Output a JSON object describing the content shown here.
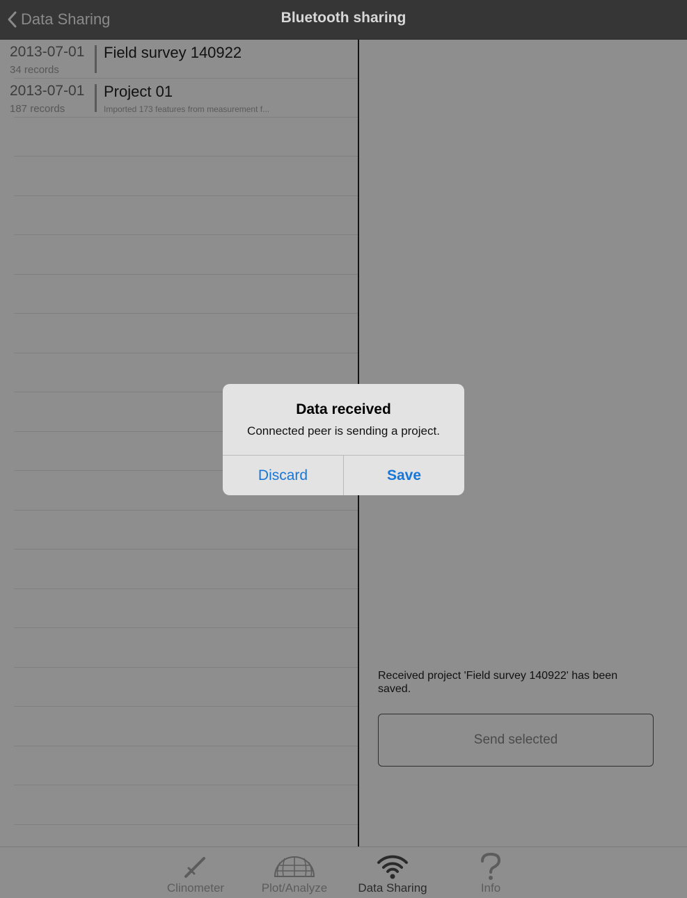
{
  "navbar": {
    "back_label": "Data Sharing",
    "title": "Bluetooth sharing"
  },
  "projects": [
    {
      "date": "2013-07-01",
      "records": "34 records",
      "name": "Field survey 140922",
      "description": ""
    },
    {
      "date": "2013-07-01",
      "records": "187 records",
      "name": "Project 01",
      "description": "Imported 173 features from measurement f..."
    }
  ],
  "detail": {
    "status_message": "Received project 'Field survey 140922' has been saved.",
    "send_button_label": "Send selected"
  },
  "alert": {
    "title": "Data received",
    "message": "Connected peer is sending a project.",
    "discard_label": "Discard",
    "save_label": "Save"
  },
  "tabs": [
    {
      "label": "Clinometer",
      "icon": "clinometer-icon"
    },
    {
      "label": "Plot/Analyze",
      "icon": "globe-icon"
    },
    {
      "label": "Data Sharing",
      "icon": "wifi-icon"
    },
    {
      "label": "Info",
      "icon": "question-icon"
    }
  ],
  "colors": {
    "navbar": "#363636",
    "background": "#8e8e8e",
    "alert_button": "#1777d8"
  }
}
